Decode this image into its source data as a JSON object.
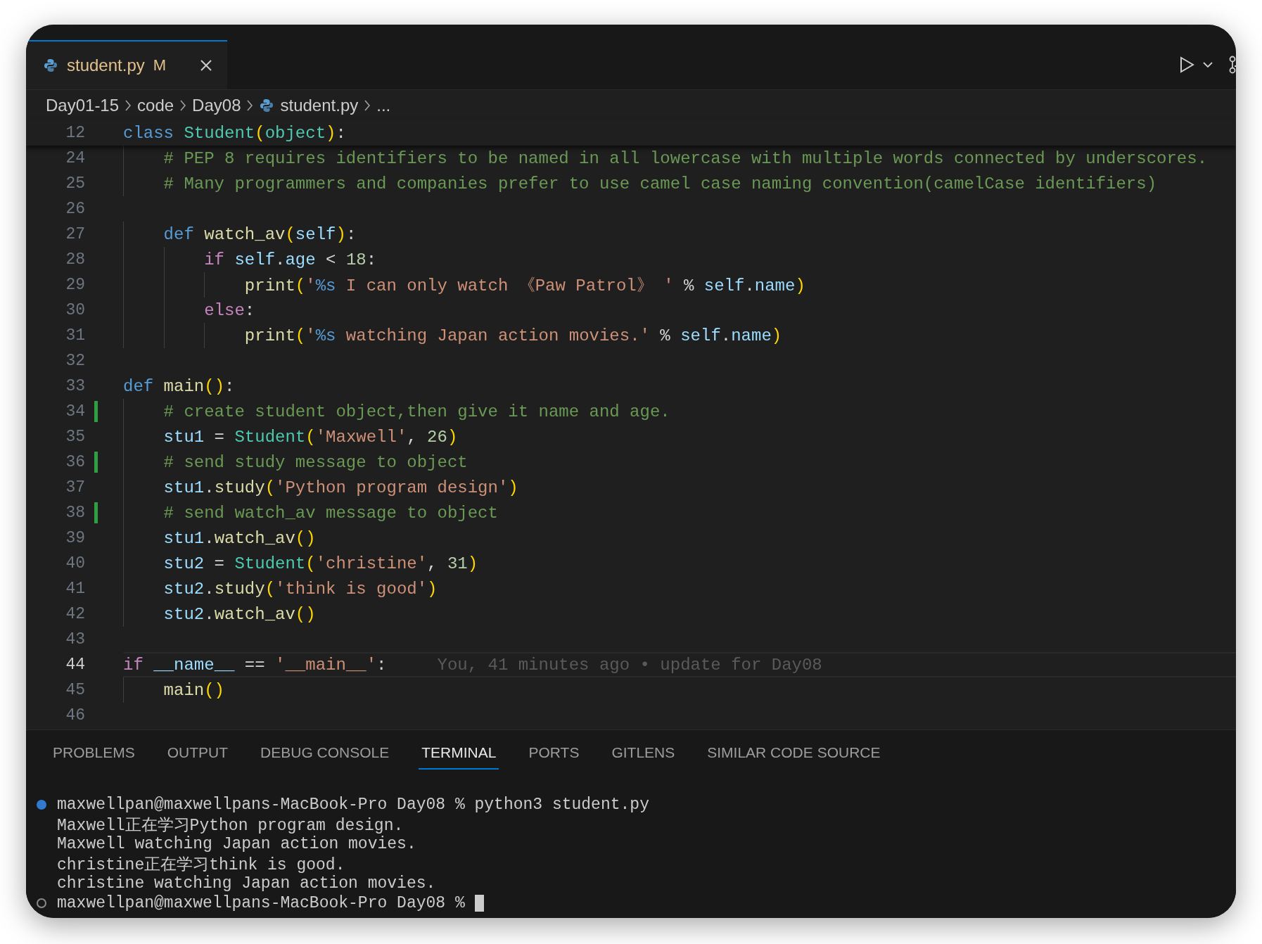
{
  "tabs": [
    {
      "label": "student.py",
      "badge": "M",
      "selected": true
    }
  ],
  "breadcrumbs": [
    {
      "label": "Day01-15",
      "kind": "folder"
    },
    {
      "label": "code",
      "kind": "folder"
    },
    {
      "label": "Day08",
      "kind": "folder"
    },
    {
      "label": "student.py",
      "kind": "file"
    },
    {
      "label": "...",
      "kind": "more"
    }
  ],
  "sticky_line": {
    "number": "12",
    "tokens": [
      {
        "text": "class",
        "kind": "keyword"
      },
      {
        "text": " Student",
        "kind": "class"
      },
      {
        "text": "(",
        "kind": "bracket"
      },
      {
        "text": "object",
        "kind": "class"
      },
      {
        "text": ")",
        "kind": "bracket"
      },
      {
        "text": ":",
        "kind": "plain"
      }
    ]
  },
  "lines": [
    {
      "number": "24",
      "current": false,
      "modified": false,
      "tokens": [
        {
          "text": "    # PEP 8 requires identifiers to be named in all lowercase with multiple words connected by underscores.",
          "kind": "comment"
        }
      ]
    },
    {
      "number": "25",
      "current": false,
      "modified": false,
      "tokens": [
        {
          "text": "    # Many programmers and companies prefer to use camel case naming convention(camelCase identifiers)",
          "kind": "comment"
        }
      ]
    },
    {
      "number": "26",
      "current": false,
      "modified": false
    },
    {
      "number": "27",
      "current": false,
      "modified": false,
      "tokens": [
        {
          "text": "    def",
          "kind": "keyword"
        },
        {
          "text": " watch_av",
          "kind": "function"
        },
        {
          "text": "(",
          "kind": "bracket"
        },
        {
          "text": "self",
          "kind": "variable"
        },
        {
          "text": ")",
          "kind": "bracket"
        },
        {
          "text": ":",
          "kind": "plain"
        }
      ]
    },
    {
      "number": "28",
      "current": false,
      "modified": false,
      "tokens": [
        {
          "text": "        if",
          "kind": "control"
        },
        {
          "text": " self",
          "kind": "variable"
        },
        {
          "text": ".",
          "kind": "plain"
        },
        {
          "text": "age",
          "kind": "variable"
        },
        {
          "text": " < ",
          "kind": "plain"
        },
        {
          "text": "18",
          "kind": "number"
        },
        {
          "text": ":",
          "kind": "plain"
        }
      ]
    },
    {
      "number": "29",
      "current": false,
      "modified": false,
      "tokens": [
        {
          "text": "            print",
          "kind": "function"
        },
        {
          "text": "(",
          "kind": "bracket"
        },
        {
          "text": "'",
          "kind": "string"
        },
        {
          "text": "%s",
          "kind": "format"
        },
        {
          "text": " I can only watch 《Paw Patrol》 '",
          "kind": "string"
        },
        {
          "text": " % ",
          "kind": "plain"
        },
        {
          "text": "self",
          "kind": "variable"
        },
        {
          "text": ".",
          "kind": "plain"
        },
        {
          "text": "name",
          "kind": "variable"
        },
        {
          "text": ")",
          "kind": "bracket"
        }
      ]
    },
    {
      "number": "30",
      "current": false,
      "modified": false,
      "tokens": [
        {
          "text": "        else",
          "kind": "control"
        },
        {
          "text": ":",
          "kind": "plain"
        }
      ]
    },
    {
      "number": "31",
      "current": false,
      "modified": false,
      "tokens": [
        {
          "text": "            print",
          "kind": "function"
        },
        {
          "text": "(",
          "kind": "bracket"
        },
        {
          "text": "'",
          "kind": "string"
        },
        {
          "text": "%s",
          "kind": "format"
        },
        {
          "text": " watching Japan action movies.'",
          "kind": "string"
        },
        {
          "text": " % ",
          "kind": "plain"
        },
        {
          "text": "self",
          "kind": "variable"
        },
        {
          "text": ".",
          "kind": "plain"
        },
        {
          "text": "name",
          "kind": "variable"
        },
        {
          "text": ")",
          "kind": "bracket"
        }
      ]
    },
    {
      "number": "32",
      "current": false,
      "modified": false
    },
    {
      "number": "33",
      "current": false,
      "modified": false,
      "tokens": [
        {
          "text": "def",
          "kind": "keyword"
        },
        {
          "text": " main",
          "kind": "function"
        },
        {
          "text": "()",
          "kind": "bracket"
        },
        {
          "text": ":",
          "kind": "plain"
        }
      ]
    },
    {
      "number": "34",
      "current": false,
      "modified": true,
      "tokens": [
        {
          "text": "    # create student object,then give it name and age.",
          "kind": "comment"
        }
      ]
    },
    {
      "number": "35",
      "current": false,
      "modified": false,
      "tokens": [
        {
          "text": "    stu1",
          "kind": "variable"
        },
        {
          "text": " = ",
          "kind": "plain"
        },
        {
          "text": "Student",
          "kind": "class"
        },
        {
          "text": "(",
          "kind": "bracket"
        },
        {
          "text": "'Maxwell'",
          "kind": "string"
        },
        {
          "text": ", ",
          "kind": "plain"
        },
        {
          "text": "26",
          "kind": "number"
        },
        {
          "text": ")",
          "kind": "bracket"
        }
      ]
    },
    {
      "number": "36",
      "current": false,
      "modified": true,
      "tokens": [
        {
          "text": "    # send study message to object",
          "kind": "comment"
        }
      ]
    },
    {
      "number": "37",
      "current": false,
      "modified": false,
      "tokens": [
        {
          "text": "    stu1",
          "kind": "variable"
        },
        {
          "text": ".",
          "kind": "plain"
        },
        {
          "text": "study",
          "kind": "function"
        },
        {
          "text": "(",
          "kind": "bracket"
        },
        {
          "text": "'Python program design'",
          "kind": "string"
        },
        {
          "text": ")",
          "kind": "bracket"
        }
      ]
    },
    {
      "number": "38",
      "current": false,
      "modified": true,
      "tokens": [
        {
          "text": "    # send watch_av message to object",
          "kind": "comment"
        }
      ]
    },
    {
      "number": "39",
      "current": false,
      "modified": false,
      "tokens": [
        {
          "text": "    stu1",
          "kind": "variable"
        },
        {
          "text": ".",
          "kind": "plain"
        },
        {
          "text": "watch_av",
          "kind": "function"
        },
        {
          "text": "()",
          "kind": "bracket"
        }
      ]
    },
    {
      "number": "40",
      "current": false,
      "modified": false,
      "tokens": [
        {
          "text": "    stu2",
          "kind": "variable"
        },
        {
          "text": " = ",
          "kind": "plain"
        },
        {
          "text": "Student",
          "kind": "class"
        },
        {
          "text": "(",
          "kind": "bracket"
        },
        {
          "text": "'christine'",
          "kind": "string"
        },
        {
          "text": ", ",
          "kind": "plain"
        },
        {
          "text": "31",
          "kind": "number"
        },
        {
          "text": ")",
          "kind": "bracket"
        }
      ]
    },
    {
      "number": "41",
      "current": false,
      "modified": false,
      "tokens": [
        {
          "text": "    stu2",
          "kind": "variable"
        },
        {
          "text": ".",
          "kind": "plain"
        },
        {
          "text": "study",
          "kind": "function"
        },
        {
          "text": "(",
          "kind": "bracket"
        },
        {
          "text": "'think is good'",
          "kind": "string"
        },
        {
          "text": ")",
          "kind": "bracket"
        }
      ]
    },
    {
      "number": "42",
      "current": false,
      "modified": false,
      "tokens": [
        {
          "text": "    stu2",
          "kind": "variable"
        },
        {
          "text": ".",
          "kind": "plain"
        },
        {
          "text": "watch_av",
          "kind": "function"
        },
        {
          "text": "()",
          "kind": "bracket"
        }
      ]
    },
    {
      "number": "43",
      "current": false,
      "modified": false
    },
    {
      "number": "44",
      "current": true,
      "modified": false,
      "blame": "You, 41 minutes ago • update for Day08",
      "tokens": [
        {
          "text": "if",
          "kind": "control"
        },
        {
          "text": " __name__",
          "kind": "variable"
        },
        {
          "text": " == ",
          "kind": "plain"
        },
        {
          "text": "'__main__'",
          "kind": "string"
        },
        {
          "text": ":",
          "kind": "plain"
        }
      ]
    },
    {
      "number": "45",
      "current": false,
      "modified": false,
      "tokens": [
        {
          "text": "    main",
          "kind": "function"
        },
        {
          "text": "()",
          "kind": "bracket"
        }
      ]
    },
    {
      "number": "46",
      "current": false,
      "modified": false
    }
  ],
  "panel_tabs": [
    {
      "label": "PROBLEMS",
      "selected": false
    },
    {
      "label": "OUTPUT",
      "selected": false
    },
    {
      "label": "DEBUG CONSOLE",
      "selected": false
    },
    {
      "label": "TERMINAL",
      "selected": true
    },
    {
      "label": "PORTS",
      "selected": false
    },
    {
      "label": "GITLENS",
      "selected": false
    },
    {
      "label": "SIMILAR CODE SOURCE",
      "selected": false
    }
  ],
  "terminal": [
    {
      "kind": "command",
      "text": "maxwellpan@maxwellpans-MacBook-Pro Day08 % python3 student.py"
    },
    {
      "kind": "output",
      "text": "Maxwell正在学习Python program design."
    },
    {
      "kind": "output",
      "text": "Maxwell watching Japan action movies."
    },
    {
      "kind": "output",
      "text": "christine正在学习think is good."
    },
    {
      "kind": "output",
      "text": "christine watching Japan action movies."
    },
    {
      "kind": "prompt",
      "text": "maxwellpan@maxwellpans-MacBook-Pro Day08 %"
    }
  ]
}
